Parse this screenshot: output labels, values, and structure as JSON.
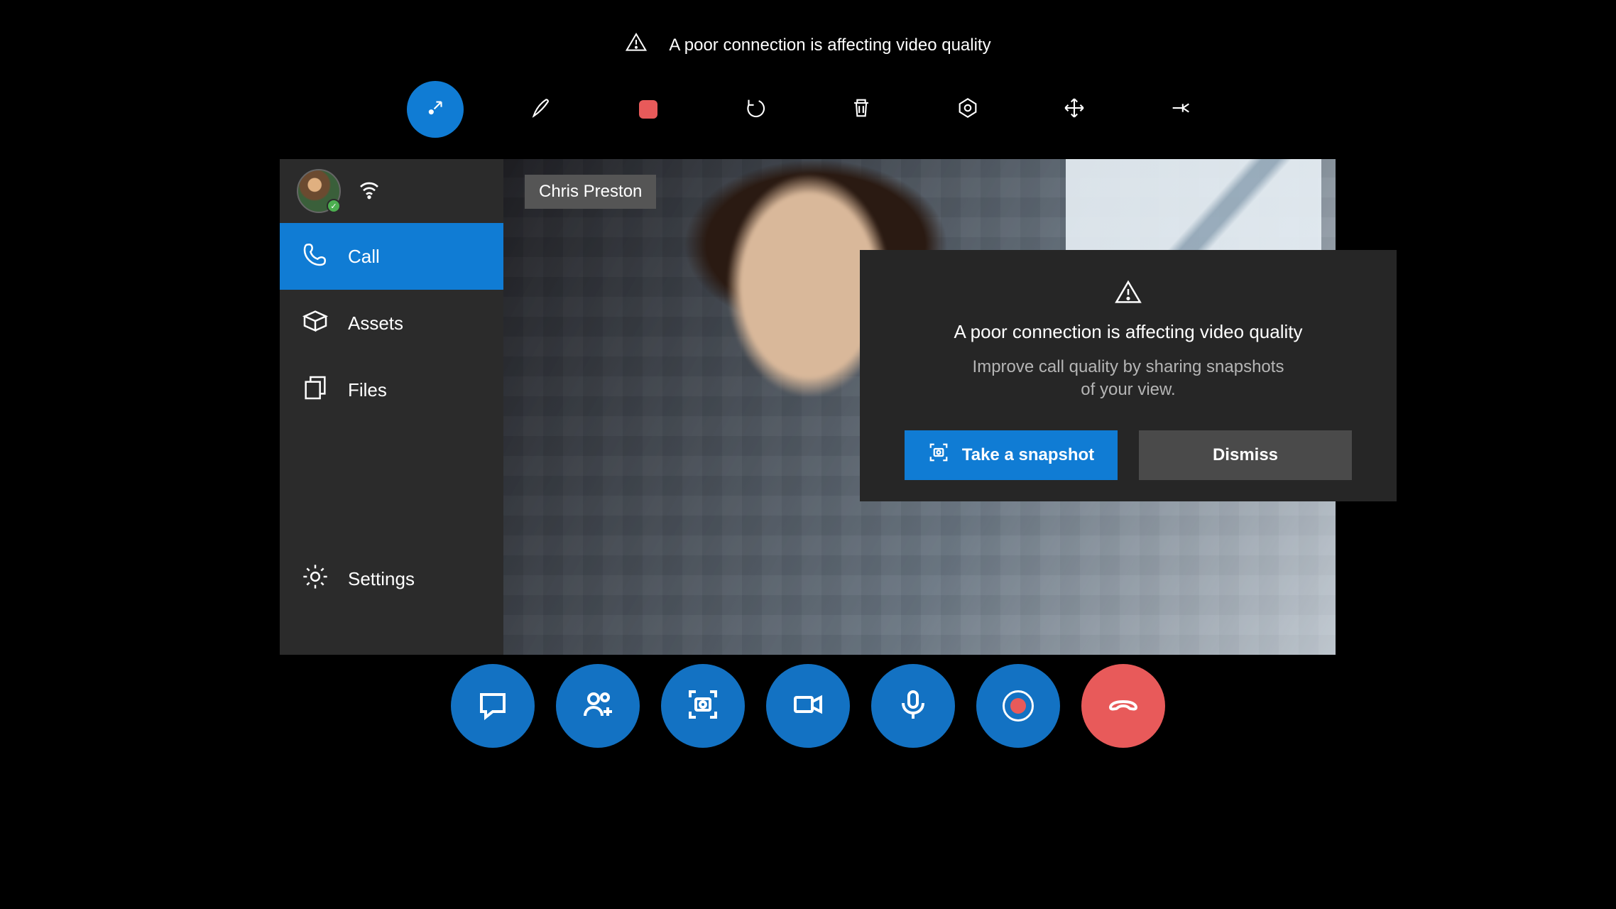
{
  "top_warning": {
    "text": "A poor connection is affecting video quality"
  },
  "toolbar": {
    "items": [
      {
        "name": "minimize-inward-icon",
        "active": true
      },
      {
        "name": "pen-icon"
      },
      {
        "name": "stop-record-icon"
      },
      {
        "name": "undo-icon"
      },
      {
        "name": "trash-icon"
      },
      {
        "name": "aperture-icon"
      },
      {
        "name": "move-arrows-icon"
      },
      {
        "name": "pin-icon"
      }
    ]
  },
  "sidebar": {
    "user": {
      "presence": "available"
    },
    "items": [
      {
        "key": "call",
        "label": "Call",
        "icon": "phone-icon",
        "active": true
      },
      {
        "key": "assets",
        "label": "Assets",
        "icon": "box-icon",
        "active": false
      },
      {
        "key": "files",
        "label": "Files",
        "icon": "files-icon",
        "active": false
      },
      {
        "key": "settings",
        "label": "Settings",
        "icon": "gear-icon",
        "active": false
      }
    ]
  },
  "video": {
    "remote_name": "Chris Preston"
  },
  "dialog": {
    "title": "A poor connection is affecting video quality",
    "body_line1": "Improve call quality by sharing snapshots",
    "body_line2": "of your view.",
    "primary_label": "Take a snapshot",
    "secondary_label": "Dismiss"
  },
  "call_controls": {
    "items": [
      {
        "name": "chat-button",
        "icon": "chat-icon"
      },
      {
        "name": "add-people-button",
        "icon": "people-add-icon"
      },
      {
        "name": "snapshot-button",
        "icon": "camera-frame-icon"
      },
      {
        "name": "video-button",
        "icon": "video-icon"
      },
      {
        "name": "mic-button",
        "icon": "mic-icon"
      },
      {
        "name": "record-button",
        "icon": "record-icon"
      },
      {
        "name": "hangup-button",
        "icon": "hangup-icon",
        "style": "hangup"
      }
    ]
  }
}
